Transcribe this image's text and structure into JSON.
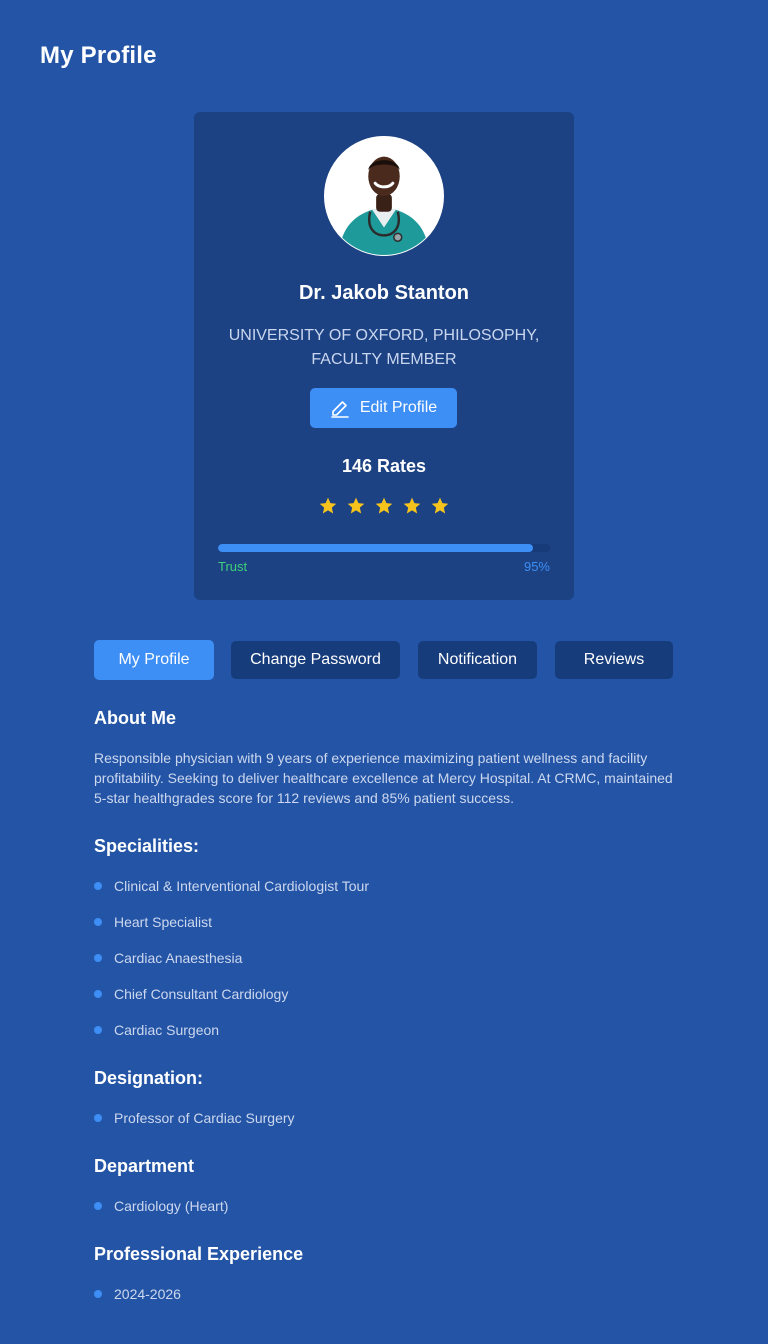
{
  "header": {
    "title": "My Profile"
  },
  "profile": {
    "name": "Dr. Jakob Stanton",
    "subtitle": "UNIVERSITY OF OXFORD, PHILOSOPHY, FACULTY MEMBER",
    "edit_label": "Edit Profile",
    "rates_label": "146 Rates",
    "rating": 5,
    "rating_max": 5,
    "trust_label": "Trust",
    "trust_value": "95%",
    "trust_fraction": 0.95
  },
  "tabs": [
    {
      "label": "My Profile",
      "active": true
    },
    {
      "label": "Change Password",
      "active": false
    },
    {
      "label": "Notification",
      "active": false
    },
    {
      "label": "Reviews",
      "active": false
    }
  ],
  "about": {
    "title": "About Me",
    "text": "Responsible physician with 9 years of experience maximizing patient wellness and facility profitability. Seeking to deliver healthcare excellence at Mercy Hospital. At CRMC, maintained 5-star healthgrades score for 112 reviews and 85% patient success."
  },
  "specialities": {
    "title": "Specialities:",
    "items": [
      "Clinical & Interventional Cardiologist  Tour",
      "Heart Specialist",
      "Cardiac Anaesthesia",
      "Chief Consultant Cardiology",
      "Cardiac Surgeon"
    ]
  },
  "designation": {
    "title": "Designation:",
    "items": [
      "Professor of Cardiac Surgery"
    ]
  },
  "department": {
    "title": "Department",
    "items": [
      "Cardiology (Heart)"
    ]
  },
  "experience": {
    "title": "Professional Experience",
    "items": [
      "2024-2026"
    ]
  },
  "colors": {
    "background": "#2354a6",
    "card": "#1d4283",
    "accent": "#3d8ef5",
    "star": "#f6c31c",
    "trust_label": "#3fd17a"
  },
  "icons": {
    "edit": "pencil-icon",
    "star": "star-icon",
    "bullet": "bullet-dot"
  }
}
